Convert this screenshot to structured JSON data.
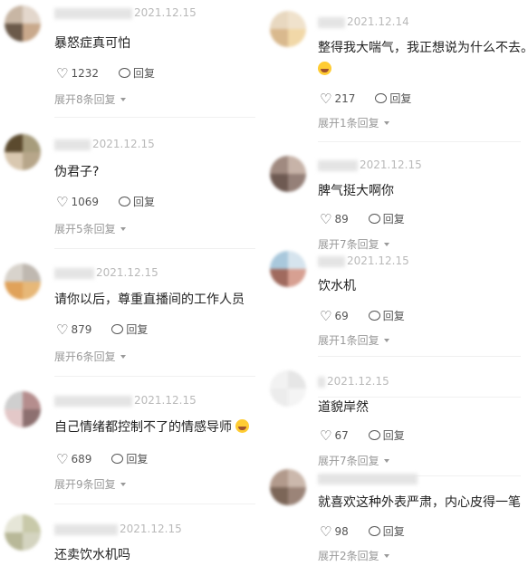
{
  "reply_label": "回复",
  "left_comments": [
    {
      "date": "2021.12.15",
      "text": "暴怒症真可怕",
      "likes": "1232",
      "expand": "展开8条回复",
      "emoji": false
    },
    {
      "date": "2021.12.15",
      "text": "伪君子?",
      "likes": "1069",
      "expand": "展开5条回复",
      "emoji": false
    },
    {
      "date": "2021.12.15",
      "text": "请你以后，尊重直播间的工作人员",
      "likes": "879",
      "expand": "展开6条回复",
      "emoji": false
    },
    {
      "date": "2021.12.15",
      "text": "自己情绪都控制不了的情感导师",
      "likes": "689",
      "expand": "展开9条回复",
      "emoji": true
    },
    {
      "date": "2021.12.15",
      "text": "还卖饮水机吗",
      "likes": "",
      "expand": "",
      "emoji": false
    }
  ],
  "right_comments": [
    {
      "date": "2021.12.14",
      "text": "整得我大喘气，我正想说为什么不去。",
      "likes": "217",
      "expand": "展开1条回复",
      "emoji": true
    },
    {
      "date": "2021.12.15",
      "text": "脾气挺大啊你",
      "likes": "89",
      "expand": "展开7条回复",
      "emoji": false
    },
    {
      "date": "2021.12.15",
      "text": "饮水机",
      "likes": "69",
      "expand": "展开1条回复",
      "emoji": false
    },
    {
      "date": "2021.12.15",
      "text": "道貌岸然",
      "likes": "67",
      "expand": "展开7条回复",
      "emoji": false
    },
    {
      "date": "",
      "text": "就喜欢这种外表严肃，内心皮得一笔",
      "likes": "98",
      "expand": "展开2条回复",
      "emoji": false
    }
  ]
}
